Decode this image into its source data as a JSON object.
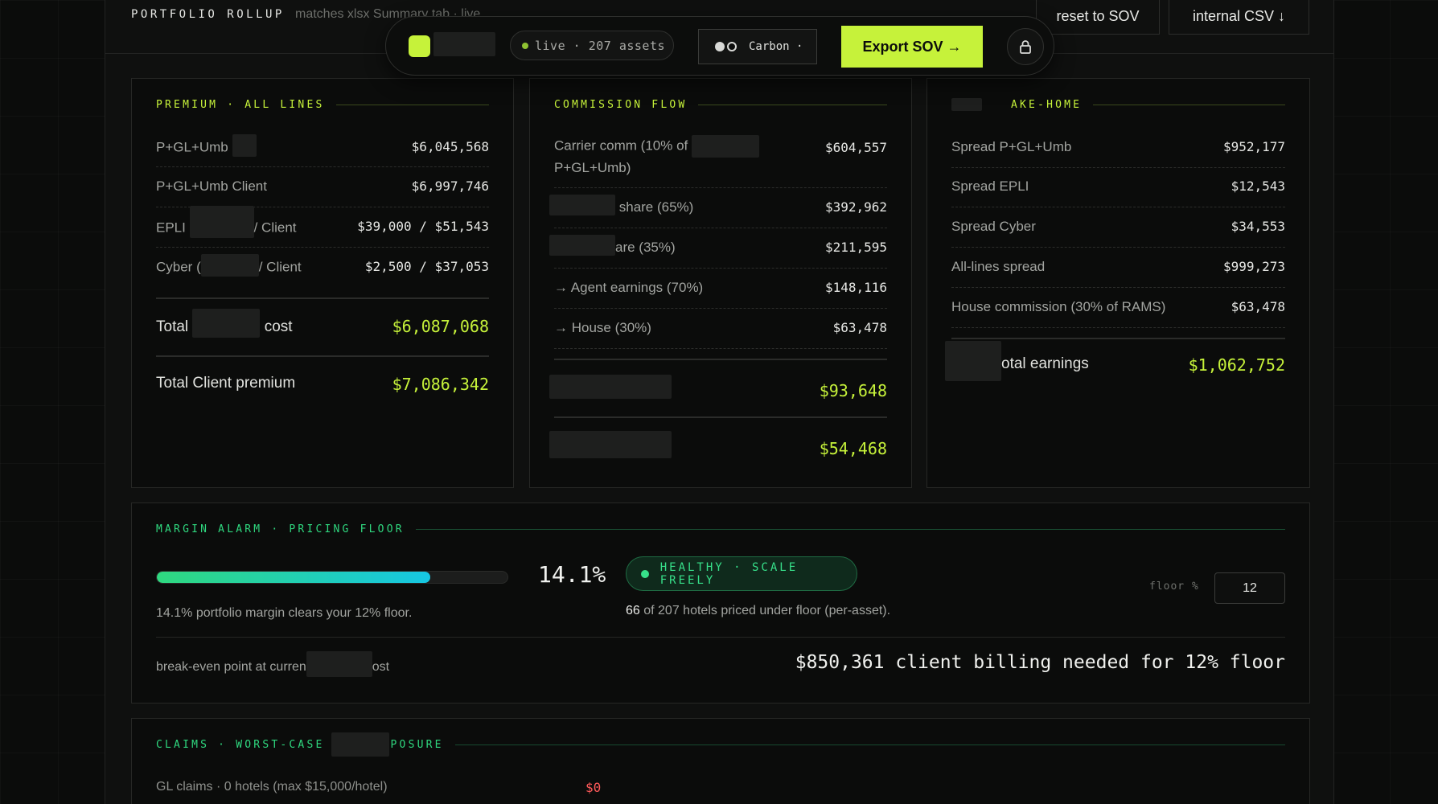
{
  "header": {
    "title": "PORTFOLIO ROLLUP",
    "subtitle": "matches xlsx Summary tab · live",
    "reset_label": "reset to SOV",
    "csv_label": "internal CSV ↓"
  },
  "toolbar": {
    "status": "live · 207 assets",
    "theme": "Carbon ·",
    "export_label": "Export SOV →",
    "accent": "#c6f23a"
  },
  "premium": {
    "heading": "PREMIUM · ALL LINES",
    "rows": [
      {
        "label": "P+GL+Umb",
        "value": "$6,045,568"
      },
      {
        "label": "P+GL+Umb Client",
        "value": "$6,997,746"
      },
      {
        "label_a": "EPLI",
        "label_b": "/ Client",
        "value": "$39,000 / $51,543"
      },
      {
        "label_a": "Cyber (",
        "label_b": "/ Client",
        "value": "$2,500 / $37,053"
      }
    ],
    "total_cost_a": "Total",
    "total_cost_b": "cost",
    "total_cost_value": "$6,087,068",
    "total_client_label": "Total Client premium",
    "total_client_value": "$7,086,342"
  },
  "commission": {
    "heading": "COMMISSION FLOW",
    "rows": [
      {
        "label_a": "Carrier comm (10% of",
        "label_b": "P+GL+Umb)",
        "value": "$604,557"
      },
      {
        "label": "share (65%)",
        "value": "$392,962"
      },
      {
        "label": "are (35%)",
        "value": "$211,595"
      },
      {
        "label": "→ Agent earnings (70%)",
        "value": "$148,116"
      },
      {
        "label": "→ House (30%)",
        "value": "$63,478"
      }
    ],
    "total_a_value": "$93,648",
    "total_b_value": "$54,468"
  },
  "takehome": {
    "heading": "AKE-HOME",
    "rows": [
      {
        "label": "Spread P+GL+Umb",
        "value": "$952,177"
      },
      {
        "label": "Spread EPLI",
        "value": "$12,543"
      },
      {
        "label": "Spread Cyber",
        "value": "$34,553"
      },
      {
        "label": "All-lines spread",
        "value": "$999,273"
      },
      {
        "label": "House commission (30% of RAMS)",
        "value": "$63,478"
      }
    ],
    "total_label": "otal earnings",
    "total_value": "$1,062,752"
  },
  "margin": {
    "heading": "MARGIN ALARM · PRICING FLOOR",
    "percent_text": "14.1%",
    "progress_fraction": 0.78,
    "status": "HEALTHY · SCALE FREELY",
    "note": "14.1% portfolio margin clears your 12% floor.",
    "under_count": "66",
    "under_note": " of 207 hotels priced under floor (per-asset).",
    "floor_label": "floor %",
    "floor_value": "12",
    "breakeven_a": "break-even point at curren",
    "breakeven_b": "ost",
    "breakeven_value": "$850,361 client billing needed for 12% floor"
  },
  "claims": {
    "heading_a": "CLAIMS · WORST-CASE",
    "heading_b": "POSURE",
    "gl_label": "GL claims · 0 hotels (max $15,000/hotel)",
    "gl_value": "$0"
  }
}
